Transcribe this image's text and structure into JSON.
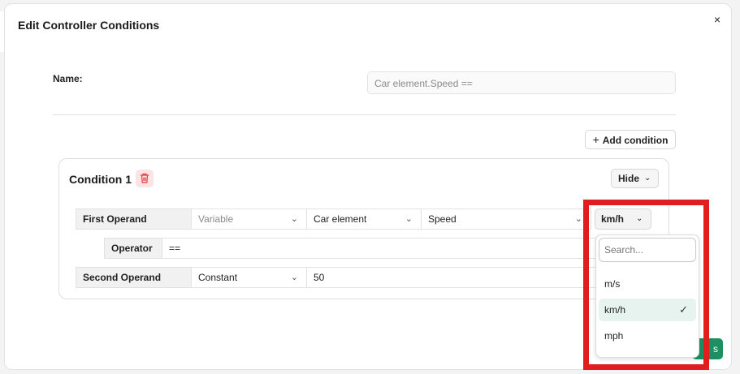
{
  "dialog": {
    "title": "Edit Controller Conditions",
    "close_glyph": "×"
  },
  "name_field": {
    "label": "Name:",
    "value": "Car element.Speed =="
  },
  "add_condition": {
    "label": "Add condition",
    "icon": "plus-icon"
  },
  "condition": {
    "title": "Condition 1",
    "delete_icon": "trash-icon",
    "hide_label": "Hide",
    "first_operand": {
      "label": "First Operand",
      "type": "Variable",
      "element": "Car element",
      "property": "Speed",
      "unit": "km/h"
    },
    "operator": {
      "label": "Operator",
      "value": "=="
    },
    "second_operand": {
      "label": "Second Operand",
      "type": "Constant",
      "value": "50"
    }
  },
  "unit_dropdown": {
    "search_placeholder": "Search...",
    "options": [
      "m/s",
      "km/h",
      "mph"
    ],
    "selected": "km/h"
  },
  "partial_button_text": "s",
  "colors": {
    "highlight": "#e21d1d",
    "accent_green": "#1d8f61",
    "delete_red": "#e0393e"
  }
}
